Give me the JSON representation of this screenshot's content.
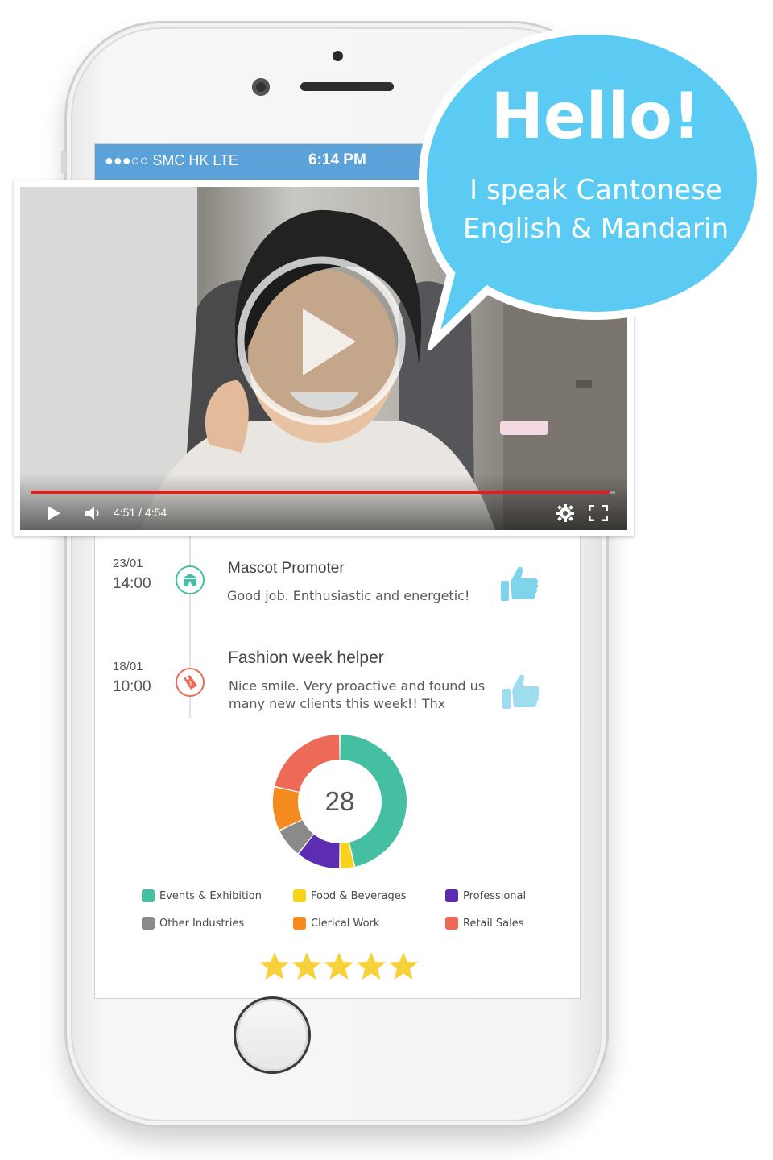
{
  "status_bar": {
    "carrier": "●●●○○ SMC HK   LTE",
    "time": "6:14 PM"
  },
  "video": {
    "time_display": "4:51 / 4:54",
    "progress_fraction": 0.99,
    "play_icon": "play-icon",
    "volume_icon": "volume-icon",
    "settings_icon": "gear-icon",
    "fullscreen_icon": "fullscreen-icon"
  },
  "speech_bubble": {
    "greeting": "Hello!",
    "line1": "I speak Cantonese",
    "line2": "English & Mandarin",
    "color": "#5bcbf3"
  },
  "timeline": [
    {
      "day": "23/01",
      "hour": "14:00",
      "title": "Mascot Promoter",
      "review": "Good job. Enthusiastic and energetic!",
      "icon": "tent-icon",
      "icon_color": "#46be9f",
      "rating_icon": "thumbs-up-icon"
    },
    {
      "day": "18/01",
      "hour": "10:00",
      "title": "Fashion week helper",
      "review_line1": "Nice smile. Very proactive and found us",
      "review_line2": "many new clients this week!! Thx",
      "icon": "price-tag-icon",
      "icon_color": "#ec6a57",
      "rating_icon": "thumbs-up-icon"
    }
  ],
  "chart_data": {
    "type": "pie",
    "center_label": "28",
    "categories": [
      "Events & Exhibition",
      "Food & Beverages",
      "Professional",
      "Other Industries",
      "Clerical Work",
      "Retail Sales"
    ],
    "values": [
      13,
      1,
      3,
      2,
      3,
      6
    ],
    "order_clockwise_from_top": [
      "Events & Exhibition",
      "Food & Beverages",
      "Professional",
      "Other Industries",
      "Clerical Work",
      "Retail Sales"
    ],
    "colors": [
      "#45bfa2",
      "#f9d21b",
      "#5c2db0",
      "#8a8a8a",
      "#f58a1f",
      "#ec6a57"
    ]
  },
  "legend": [
    {
      "label": "Events & Exhibition",
      "color": "#45bfa2"
    },
    {
      "label": "Food & Beverages",
      "color": "#f9d21b"
    },
    {
      "label": "Professional",
      "color": "#5c2db0"
    },
    {
      "label": "Other Industries",
      "color": "#8a8a8a"
    },
    {
      "label": "Clerical Work",
      "color": "#f58a1f"
    },
    {
      "label": "Retail Sales",
      "color": "#ec6a57"
    }
  ],
  "rating": {
    "stars": 5,
    "max": 5,
    "color": "#f7d13a"
  }
}
